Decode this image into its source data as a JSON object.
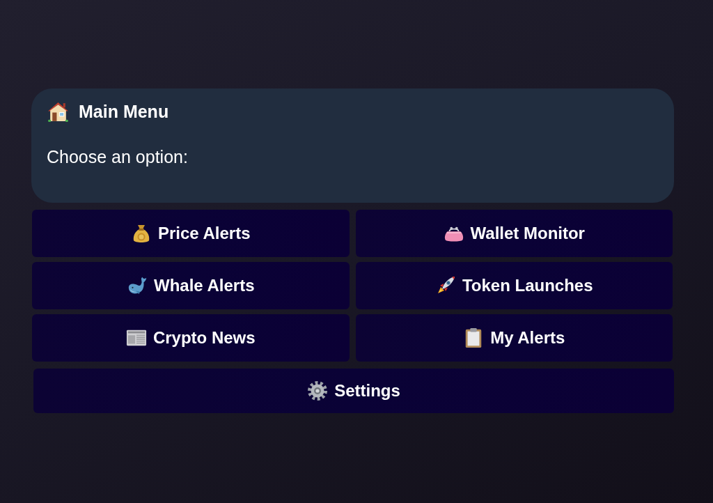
{
  "message": {
    "title": "Main Menu",
    "text": "Choose an option:"
  },
  "keyboard": [
    [
      {
        "label": "Price Alerts"
      },
      {
        "label": "Wallet Monitor"
      }
    ],
    [
      {
        "label": "Whale Alerts"
      },
      {
        "label": "Token Launches"
      }
    ],
    [
      {
        "label": "Crypto News"
      },
      {
        "label": "My Alerts"
      }
    ],
    [
      {
        "label": "Settings"
      }
    ]
  ]
}
